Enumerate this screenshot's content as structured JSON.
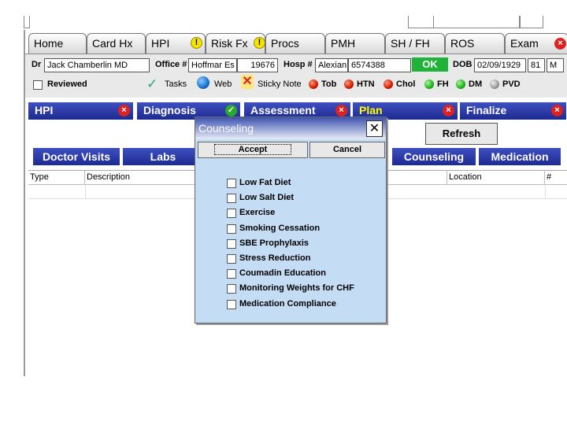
{
  "tabs": [
    {
      "label": "Home"
    },
    {
      "label": "Card Hx"
    },
    {
      "label": "HPI",
      "warn": "!"
    },
    {
      "label": "Risk Fx",
      "warn": "!"
    },
    {
      "label": "Procs"
    },
    {
      "label": "PMH"
    },
    {
      "label": "SH / FH"
    },
    {
      "label": "ROS"
    },
    {
      "label": "Exam",
      "close": "×"
    }
  ],
  "info": {
    "dr_label": "Dr",
    "dr_value": "Jack Chamberlin MD",
    "office_label": "Office #",
    "office_name": "Hoffmar Es",
    "office_num": "19676",
    "hosp_label": "Hosp #",
    "hosp_name": "Alexian",
    "hosp_num": "6574388",
    "ok_label": "OK",
    "dob_label": "DOB",
    "dob_value": "02/09/1929",
    "age_value": "81",
    "sex_value": "M",
    "reviewed_label": "Reviewed",
    "tasks_label": "Tasks",
    "web_label": "Web",
    "sticky_label": "Sticky Note",
    "indicators": [
      {
        "label": "Tob",
        "color": "red"
      },
      {
        "label": "HTN",
        "color": "red"
      },
      {
        "label": "Chol",
        "color": "red"
      },
      {
        "label": "FH",
        "color": "green"
      },
      {
        "label": "DM",
        "color": "green"
      },
      {
        "label": "PVD",
        "color": "gray"
      }
    ]
  },
  "sections": [
    {
      "label": "HPI",
      "icon": "×"
    },
    {
      "label": "Diagnosis",
      "icon": "✓"
    },
    {
      "label": "Assessment",
      "icon": "×"
    },
    {
      "label": "Plan",
      "icon": "×"
    },
    {
      "label": "Finalize",
      "icon": "×"
    }
  ],
  "refresh_label": "Refresh",
  "bottom_tabs": [
    "Doctor Visits",
    "Labs",
    "Counseling",
    "Medication"
  ],
  "grid_headers": [
    "Type",
    "Description",
    "Location",
    "#"
  ],
  "dialog": {
    "title": "Counseling",
    "close": "✕",
    "accept": "Accept",
    "cancel": "Cancel",
    "items": [
      "Low Fat Diet",
      "Low Salt Diet",
      "Exercise",
      "Smoking Cessation",
      "SBE Prophylaxis",
      "Stress Reduction",
      "Coumadin Education",
      "Monitoring Weights for CHF",
      "Medication Compliance"
    ]
  },
  "colors": {
    "section_blue": "#1d2a90",
    "dialog_bg": "#c4ddf5",
    "ok_green": "#1fb33a",
    "plan_yellow": "#ffff00"
  }
}
